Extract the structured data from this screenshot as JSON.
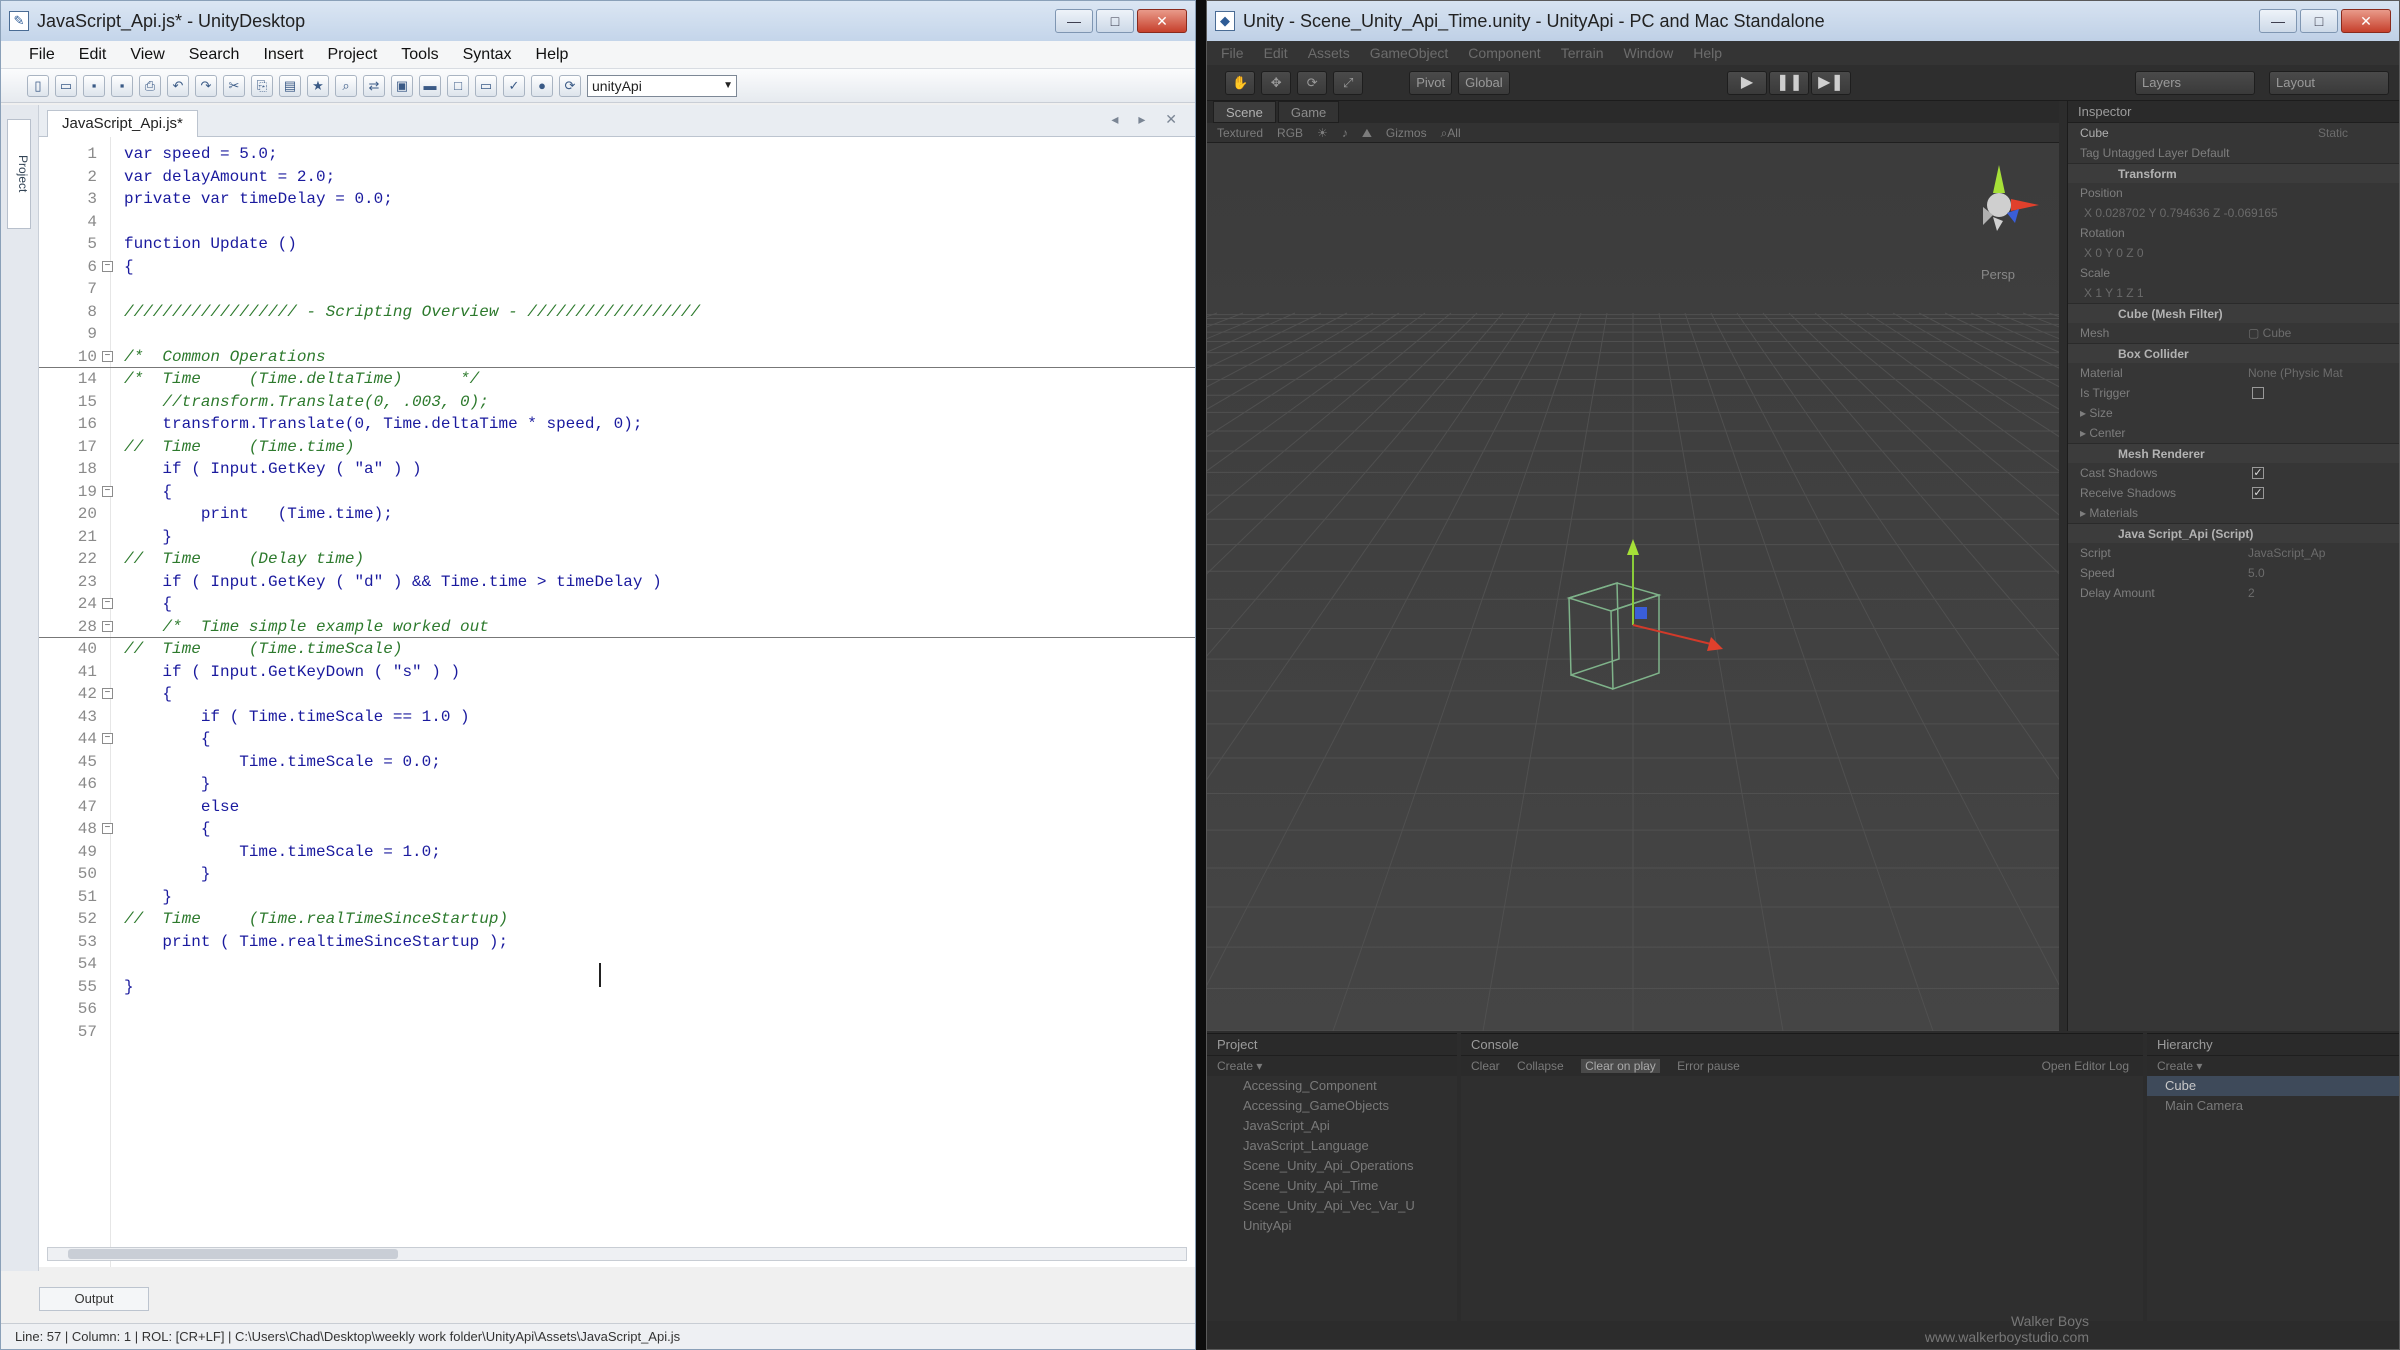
{
  "editor": {
    "title": "JavaScript_Api.js* - UnityDesktop",
    "window_buttons": [
      "—",
      "□",
      "✕"
    ],
    "menu": [
      "File",
      "Edit",
      "View",
      "Search",
      "Insert",
      "Project",
      "Tools",
      "Syntax",
      "Help"
    ],
    "toolbar_select": "unityApi",
    "file_tab": "JavaScript_Api.js*",
    "tab_nav": "◂ ▸ ✕",
    "side_tab": "Project",
    "output_tab": "Output",
    "status": "Line: 57  |  Column: 1  |  ROL: [CR+LF]  |  C:\\Users\\Chad\\Desktop\\weekly work folder\\UnityApi\\Assets\\JavaScript_Api.js",
    "code_lines": [
      {
        "n": "1",
        "t": "var speed = 5.0;"
      },
      {
        "n": "2",
        "t": "var delayAmount = 2.0;"
      },
      {
        "n": "3",
        "t": "private var timeDelay = 0.0;"
      },
      {
        "n": "4",
        "t": ""
      },
      {
        "n": "5",
        "t": "function Update ()"
      },
      {
        "n": "6",
        "t": "{",
        "fold": true
      },
      {
        "n": "7",
        "t": ""
      },
      {
        "n": "8",
        "t": "////////////////// - Scripting Overview - //////////////////",
        "c": true
      },
      {
        "n": "9",
        "t": ""
      },
      {
        "n": "10",
        "t": "/*  Common Operations",
        "c": true,
        "fold": true,
        "sep": true
      },
      {
        "n": "14",
        "t": "/*  Time     (Time.deltaTime)      */",
        "c": true
      },
      {
        "n": "15",
        "t": "    //transform.Translate(0, .003, 0);",
        "c": true
      },
      {
        "n": "16",
        "t": "    transform.Translate(0, Time.deltaTime * speed, 0);"
      },
      {
        "n": "17",
        "t": "//  Time     (Time.time)",
        "c": true
      },
      {
        "n": "18",
        "t": "    if ( Input.GetKey ( \"a\" ) )"
      },
      {
        "n": "19",
        "t": "    {",
        "fold": true
      },
      {
        "n": "20",
        "t": "        print   (Time.time);"
      },
      {
        "n": "21",
        "t": "    }"
      },
      {
        "n": "22",
        "t": "//  Time     (Delay time)",
        "c": true
      },
      {
        "n": "23",
        "t": "    if ( Input.GetKey ( \"d\" ) && Time.time > timeDelay )"
      },
      {
        "n": "24",
        "t": "    {",
        "fold": true
      },
      {
        "n": "28",
        "t": "    /*  Time simple example worked out",
        "c": true,
        "fold": true,
        "sep": true
      },
      {
        "n": "40",
        "t": "//  Time     (Time.timeScale)",
        "c": true
      },
      {
        "n": "41",
        "t": "    if ( Input.GetKeyDown ( \"s\" ) )"
      },
      {
        "n": "42",
        "t": "    {",
        "fold": true
      },
      {
        "n": "43",
        "t": "        if ( Time.timeScale == 1.0 )"
      },
      {
        "n": "44",
        "t": "        {",
        "fold": true
      },
      {
        "n": "45",
        "t": "            Time.timeScale = 0.0;"
      },
      {
        "n": "46",
        "t": "        }"
      },
      {
        "n": "47",
        "t": "        else"
      },
      {
        "n": "48",
        "t": "        {",
        "fold": true
      },
      {
        "n": "49",
        "t": "            Time.timeScale = 1.0;"
      },
      {
        "n": "50",
        "t": "        }"
      },
      {
        "n": "51",
        "t": "    }"
      },
      {
        "n": "52",
        "t": "//  Time     (Time.realTimeSinceStartup)",
        "c": true
      },
      {
        "n": "53",
        "t": "    print ( Time.realtimeSinceStartup );"
      },
      {
        "n": "54",
        "t": ""
      },
      {
        "n": "55",
        "t": "}"
      },
      {
        "n": "56",
        "t": ""
      },
      {
        "n": "57",
        "t": ""
      }
    ]
  },
  "unity": {
    "title": "Unity - Scene_Unity_Api_Time.unity - UnityApi - PC and Mac Standalone",
    "menu": [
      "File",
      "Edit",
      "Assets",
      "GameObject",
      "Component",
      "Terrain",
      "Window",
      "Help"
    ],
    "tools": [
      "✋",
      "✥",
      "⟳",
      "⤢"
    ],
    "pivot": "Pivot",
    "global": "Global",
    "play_buttons": [
      "▶",
      "❚❚",
      "▶❚"
    ],
    "layers": "Layers",
    "layout": "Layout",
    "scene_tab": "Scene",
    "game_tab": "Game",
    "scene_bar": [
      "Textured",
      "RGB",
      "☀",
      "♪",
      "⛰",
      "Gizmos",
      "⌕All"
    ],
    "persp": "Persp",
    "inspector": {
      "title": "Inspector",
      "object": "Cube",
      "static": "Static",
      "tag": "Tag  Untagged    Layer  Default",
      "rows": [
        {
          "label": "Transform",
          "type": "hdr"
        },
        {
          "label": "Position",
          "type": "row"
        },
        {
          "label": "X 0.028702    Y 0.794636    Z -0.069165",
          "type": "vec"
        },
        {
          "label": "Rotation",
          "type": "row"
        },
        {
          "label": "X 0          Y 0          Z 0",
          "type": "vec"
        },
        {
          "label": "Scale",
          "type": "row"
        },
        {
          "label": "X 1          Y 1          Z 1",
          "type": "vec"
        },
        {
          "label": "Cube (Mesh Filter)",
          "type": "hdr"
        },
        {
          "label": "Mesh",
          "type": "row",
          "val": "▢ Cube"
        },
        {
          "label": "Box Collider",
          "type": "hdr"
        },
        {
          "label": "Material",
          "type": "row",
          "val": "None (Physic Mat"
        },
        {
          "label": "Is Trigger",
          "type": "row",
          "cb": ""
        },
        {
          "label": "▸ Size",
          "type": "row"
        },
        {
          "label": "▸ Center",
          "type": "row"
        },
        {
          "label": "Mesh Renderer",
          "type": "hdr"
        },
        {
          "label": "Cast Shadows",
          "type": "row",
          "cb": "✓"
        },
        {
          "label": "Receive Shadows",
          "type": "row",
          "cb": "✓"
        },
        {
          "label": "▸ Materials",
          "type": "row"
        },
        {
          "label": "Java Script_Api (Script)",
          "type": "hdr"
        },
        {
          "label": "Script",
          "type": "row",
          "val": "JavaScript_Ap"
        },
        {
          "label": "Speed",
          "type": "row",
          "val": "5.0"
        },
        {
          "label": "Delay Amount",
          "type": "row",
          "val": "2"
        }
      ]
    },
    "project": {
      "title": "Project",
      "create": "Create ▾",
      "items": [
        "Accessing_Component",
        "Accessing_GameObjects",
        "JavaScript_Api",
        "JavaScript_Language",
        "Scene_Unity_Api_Operations",
        "Scene_Unity_Api_Time",
        "Scene_Unity_Api_Vec_Var_U",
        "UnityApi"
      ]
    },
    "console": {
      "title": "Console",
      "buttons": [
        "Clear",
        "Collapse",
        "Clear on play",
        "Error pause"
      ],
      "open": "Open Editor Log"
    },
    "hierarchy": {
      "title": "Hierarchy",
      "create": "Create ▾",
      "items": [
        "Cube",
        "Main Camera"
      ]
    },
    "watermark": [
      "Walker Boys",
      "www.walkerboystudio.com"
    ]
  }
}
